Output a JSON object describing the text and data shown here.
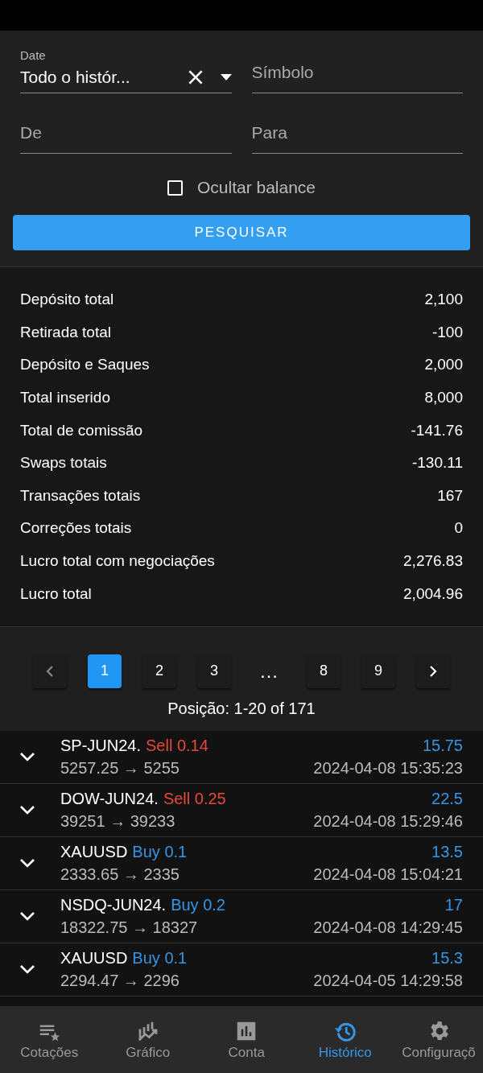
{
  "filters": {
    "date": {
      "label": "Date",
      "value": "Todo o histór..."
    },
    "symbol": {
      "placeholder": "Símbolo"
    },
    "from": {
      "placeholder": "De"
    },
    "to": {
      "placeholder": "Para"
    },
    "hide_balance": {
      "label": "Ocultar balance",
      "checked": false
    },
    "search_button": "PESQUISAR"
  },
  "summary": [
    {
      "label": "Depósito total",
      "value": "2,100"
    },
    {
      "label": "Retirada total",
      "value": "-100"
    },
    {
      "label": "Depósito e Saques",
      "value": "2,000"
    },
    {
      "label": "Total inserido",
      "value": "8,000"
    },
    {
      "label": "Total de comissão",
      "value": "-141.76"
    },
    {
      "label": "Swaps totais",
      "value": "-130.11"
    },
    {
      "label": "Transações totais",
      "value": "167"
    },
    {
      "label": "Correções totais",
      "value": "0"
    },
    {
      "label": "Lucro total com negociações",
      "value": "2,276.83"
    },
    {
      "label": "Lucro total",
      "value": "2,004.96"
    }
  ],
  "pagination": {
    "pages": [
      {
        "label": "1",
        "selected": true
      },
      {
        "label": "2",
        "selected": false
      },
      {
        "label": "3",
        "selected": false
      },
      {
        "label": "…",
        "kind": "ellipsis"
      },
      {
        "label": "8",
        "selected": false
      },
      {
        "label": "9",
        "selected": false
      }
    ],
    "position": "Posição: 1-20 of 171"
  },
  "trades": [
    {
      "symbol": "SP-JUN24.",
      "kind": "sell",
      "order": "Sell 0.14",
      "profit": "15.75",
      "prices": "5257.25 → 5255",
      "time": "2024-04-08 15:35:23"
    },
    {
      "symbol": "DOW-JUN24.",
      "kind": "sell",
      "order": "Sell 0.25",
      "profit": "22.5",
      "prices": "39251 → 39233",
      "time": "2024-04-08 15:29:46"
    },
    {
      "symbol": "XAUUSD",
      "kind": "buy",
      "order": "Buy 0.1",
      "profit": "13.5",
      "prices": "2333.65 → 2335",
      "time": "2024-04-08 15:04:21"
    },
    {
      "symbol": "NSDQ-JUN24.",
      "kind": "buy",
      "order": "Buy 0.2",
      "profit": "17",
      "prices": "18322.75 → 18327",
      "time": "2024-04-08 14:29:45"
    },
    {
      "symbol": "XAUUSD",
      "kind": "buy",
      "order": "Buy 0.1",
      "profit": "15.3",
      "prices": "2294.47 → 2296",
      "time": "2024-04-05 14:29:58"
    }
  ],
  "nav": [
    {
      "label": "Cotações",
      "selected": false
    },
    {
      "label": "Gráfico",
      "selected": false
    },
    {
      "label": "Conta",
      "selected": false
    },
    {
      "label": "Histórico",
      "selected": true
    },
    {
      "label": "Configuraçõ",
      "selected": false
    }
  ]
}
